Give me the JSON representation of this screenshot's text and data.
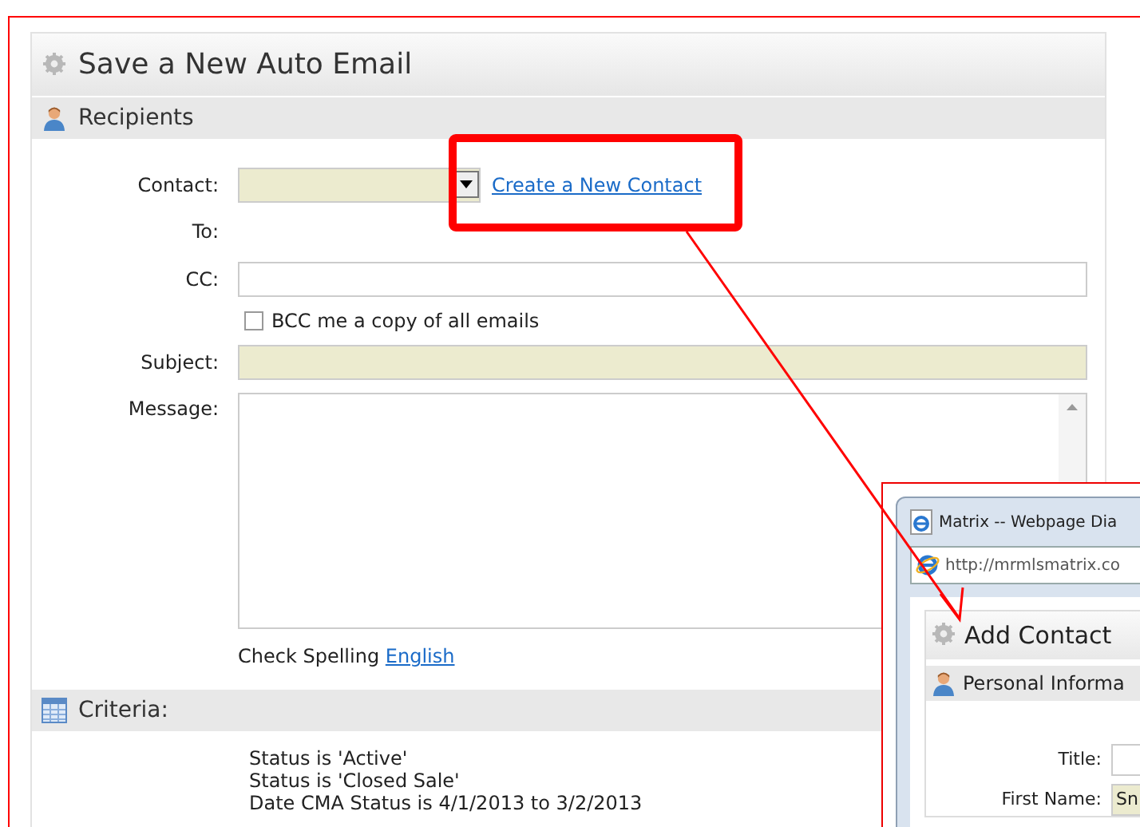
{
  "window": {
    "title": "Save a New Auto Email"
  },
  "recipients": {
    "heading": "Recipients",
    "fields": [
      {
        "kind": "select",
        "label": "Contact:",
        "required": true,
        "link": "Create a New Contact"
      },
      {
        "kind": "static",
        "label": "To:"
      },
      {
        "kind": "input",
        "label": "CC:",
        "required": false
      },
      {
        "kind": "checkbox",
        "label": "BCC me a copy of all emails",
        "checked": false
      },
      {
        "kind": "input",
        "label": "Subject:",
        "required": true
      },
      {
        "kind": "textarea",
        "label": "Message:",
        "required": false
      }
    ],
    "spelling": {
      "label": "Check Spelling",
      "link": "English"
    }
  },
  "criteria": {
    "heading": "Criteria:",
    "lines": [
      "Status is 'Active'",
      "Status is 'Closed Sale'",
      "Date CMA Status is 4/1/2013 to 3/2/2013"
    ]
  },
  "dialog": {
    "title": "Matrix -- Webpage Dia",
    "url": "http://mrmlsmatrix.co",
    "heading": "Add Contact",
    "section": "Personal Informa",
    "fields": [
      {
        "label": "Title:",
        "required": false
      },
      {
        "label": "First Name:",
        "required": true,
        "value": "Sn"
      }
    ]
  }
}
